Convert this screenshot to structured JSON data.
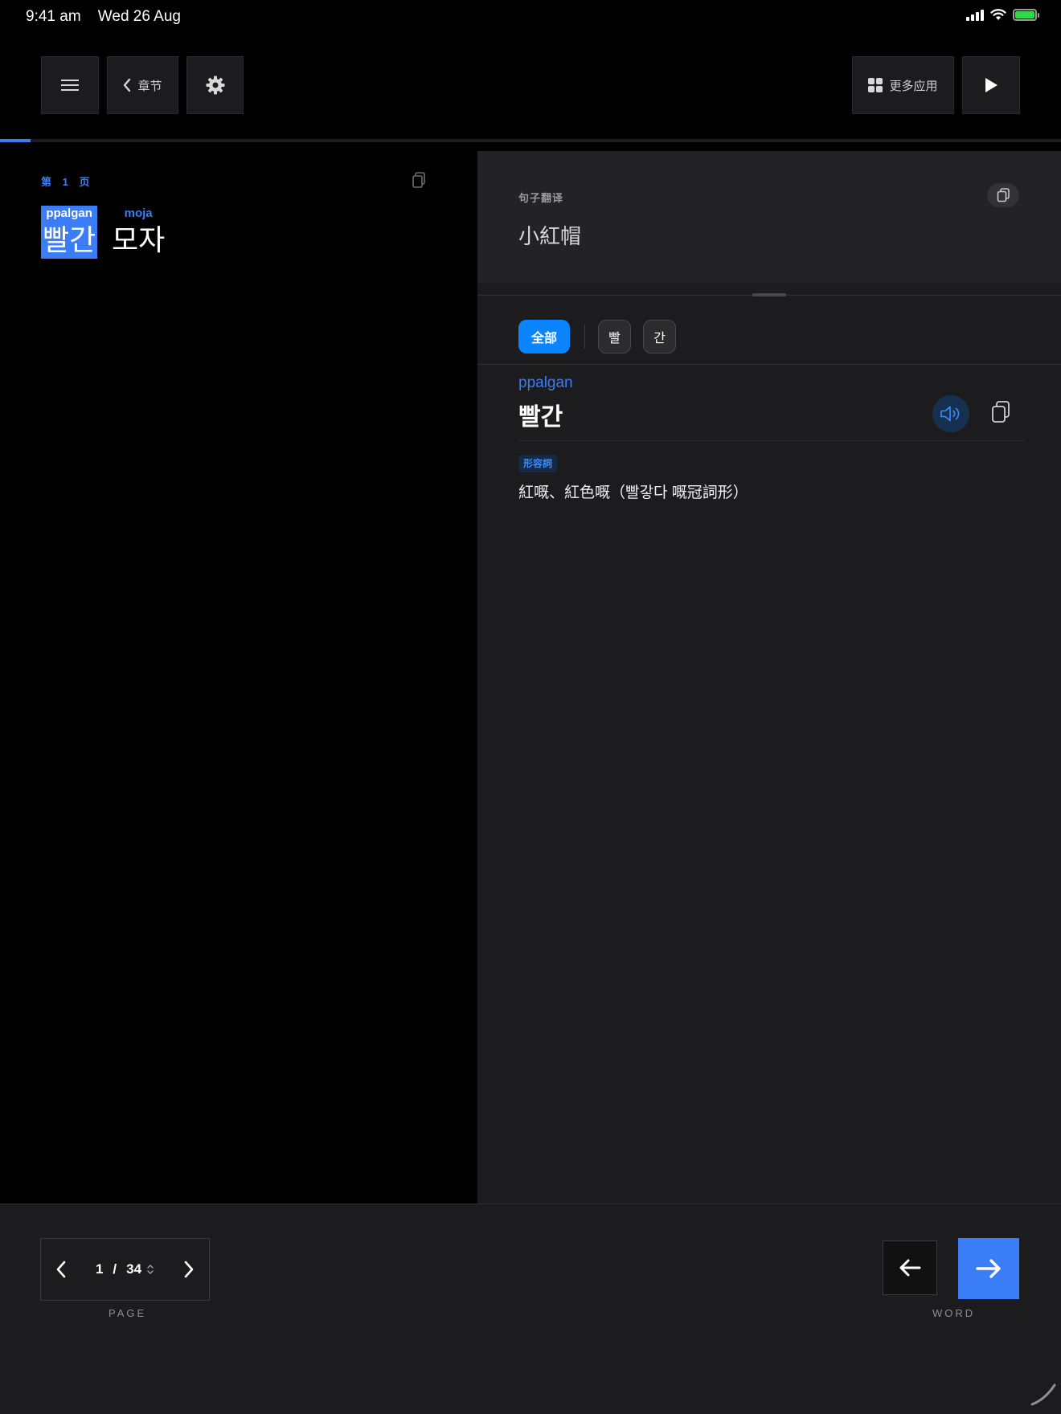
{
  "status_bar": {
    "time": "9:41 am",
    "date": "Wed 26 Aug"
  },
  "toolbar": {
    "menu_icon": "hamburger-icon",
    "chapter_label": "章节",
    "settings_icon": "gear-icon",
    "more_apps_label": "更多应用",
    "play_icon": "play-icon"
  },
  "reading_progress": 0.029,
  "left_pane": {
    "page_label": "第 1 页",
    "words": [
      {
        "roman": "ppalgan",
        "hangul": "빨간",
        "selected": true
      },
      {
        "roman": "moja",
        "hangul": "모자",
        "selected": false
      }
    ]
  },
  "translation": {
    "label": "句子翻译",
    "text": "小紅帽"
  },
  "chips": {
    "all_label": "全部",
    "syllables": [
      "빨",
      "간"
    ]
  },
  "word_detail": {
    "roman": "ppalgan",
    "hangul": "빨간",
    "pos": "形容詞",
    "definition": "紅嘅、紅色嘅（빨갛다 嘅冠詞形）"
  },
  "bottom_bar": {
    "current_page": "1",
    "total_pages": "34",
    "page_label": "PAGE",
    "word_label": "WORD"
  },
  "colors": {
    "accent": "#3a7df6",
    "chip_active": "#0a84ff",
    "battery": "#32d74b"
  }
}
